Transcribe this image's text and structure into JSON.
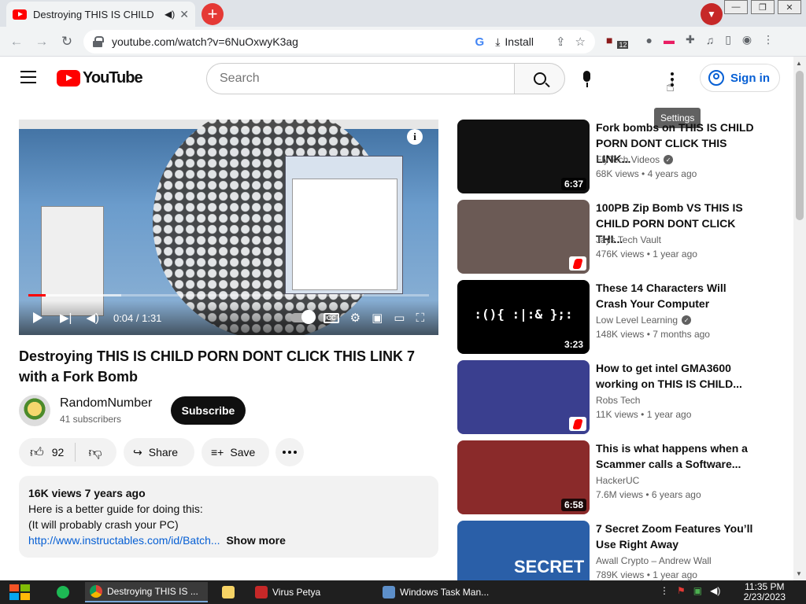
{
  "browser": {
    "tab_title": "Destroying THIS IS CHILD",
    "tab_close": "✕",
    "new_tab": "+",
    "url": "youtube.com/watch?v=6NuOxwyK3ag",
    "install_label": "Install",
    "ext_badge": "12",
    "window_buttons": [
      "—",
      "❐",
      "✕"
    ]
  },
  "youtube": {
    "logo_text": "YouTube",
    "search_placeholder": "Search",
    "signin_label": "Sign in",
    "tooltip": "Settings"
  },
  "player": {
    "time": "0:04 / 1:31",
    "progress_fraction": 0.044,
    "info_label": "i"
  },
  "video": {
    "title": "Destroying THIS IS CHILD PORN DONT CLICK THIS LINK 7 with a Fork Bomb",
    "channel": "RandomNumber",
    "subscribers": "41 subscribers",
    "subscribe_label": "Subscribe",
    "likes": "92",
    "share_label": "Share",
    "save_label": "Save"
  },
  "description": {
    "meta": "16K views  7 years ago",
    "line1": "Here is a better guide for doing this:",
    "line2": "(It will probably crash your PC)",
    "link": "http://www.instructables.com/id/Batch...",
    "show_more": "Show more"
  },
  "recommendations": [
    {
      "title": "Fork bombs on THIS IS CHILD PORN DONT CLICK THIS LINK...",
      "channel": "FlyTech Videos",
      "verified": true,
      "views": "68K views",
      "age": "4 years ago",
      "duration": "6:37",
      "shorts": false,
      "thumb_color": "#111111"
    },
    {
      "title": "100PB Zip Bomb VS THIS IS CHILD PORN DONT CLICK THI...",
      "channel": "Jays Tech Vault",
      "verified": false,
      "views": "476K views",
      "age": "1 year ago",
      "duration": "",
      "shorts": true,
      "thumb_color": "#6b5a55"
    },
    {
      "title": "These 14 Characters Will Crash Your Computer",
      "channel": "Low Level Learning",
      "verified": true,
      "views": "148K views",
      "age": "7 months ago",
      "duration": "3:23",
      "shorts": false,
      "thumb_color": "#000000",
      "thumb_text": ":(){ :|:& };:"
    },
    {
      "title": "How to get intel GMA3600 working on THIS IS CHILD...",
      "channel": "Robs Tech",
      "verified": false,
      "views": "11K views",
      "age": "1 year ago",
      "duration": "",
      "shorts": true,
      "thumb_color": "#3a3f8f"
    },
    {
      "title": "This is what happens when a Scammer calls a Software...",
      "channel": "HackerUC",
      "verified": false,
      "views": "7.6M views",
      "age": "6 years ago",
      "duration": "6:58",
      "shorts": false,
      "thumb_color": "#8a2a2a"
    },
    {
      "title": "7 Secret Zoom Features You’ll Use Right Away",
      "channel": "Awall Crypto – Andrew Wall",
      "verified": false,
      "views": "789K views",
      "age": "1 year ago",
      "duration": "",
      "shorts": false,
      "thumb_color": "#2a5fa8",
      "thumb_text": "SECRET"
    }
  ],
  "taskbar": {
    "items": [
      {
        "label": "Destroying THIS IS ...",
        "color": "#e8eaed",
        "active": true
      },
      {
        "label": "",
        "color": "#f6d365",
        "active": false
      },
      {
        "label": "Virus Petya",
        "color": "#c62828",
        "active": false
      },
      {
        "label": "Windows Task Man...",
        "color": "#5d8fc9",
        "active": false
      }
    ],
    "time": "11:35 PM",
    "date": "2/23/2023"
  }
}
